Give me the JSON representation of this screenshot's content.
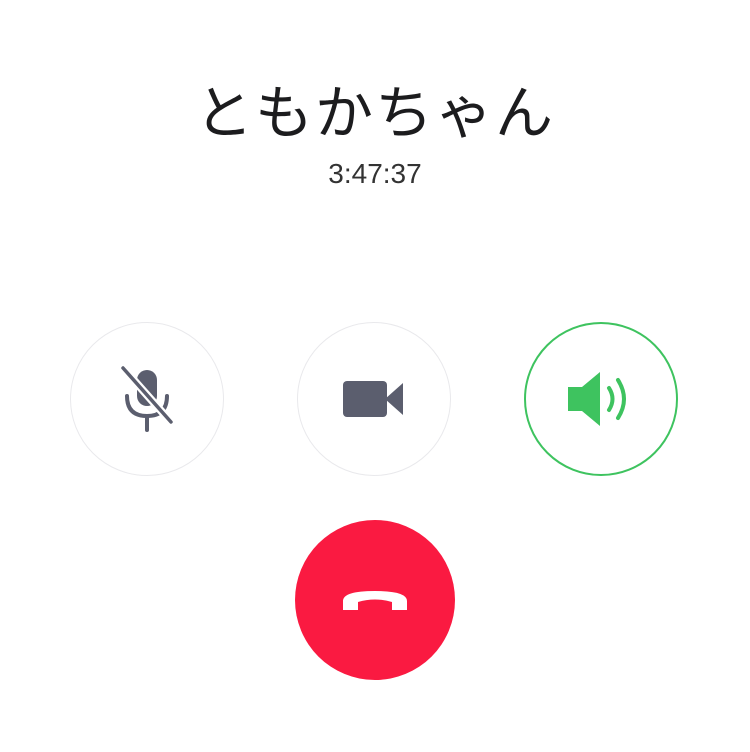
{
  "call": {
    "caller_name": "ともかちゃん",
    "duration": "3:47:37"
  },
  "controls": {
    "mute": {
      "icon": "mic-off-icon",
      "state": "off"
    },
    "video": {
      "icon": "video-camera-icon",
      "state": "off"
    },
    "speaker": {
      "icon": "speaker-icon",
      "state": "on"
    },
    "end_call": {
      "icon": "hang-up-icon"
    }
  },
  "colors": {
    "icon_gray": "#5b5e6e",
    "speaker_active": "#3ec35f",
    "end_call_red": "#fa1a41",
    "button_border": "#e9e9ec"
  }
}
